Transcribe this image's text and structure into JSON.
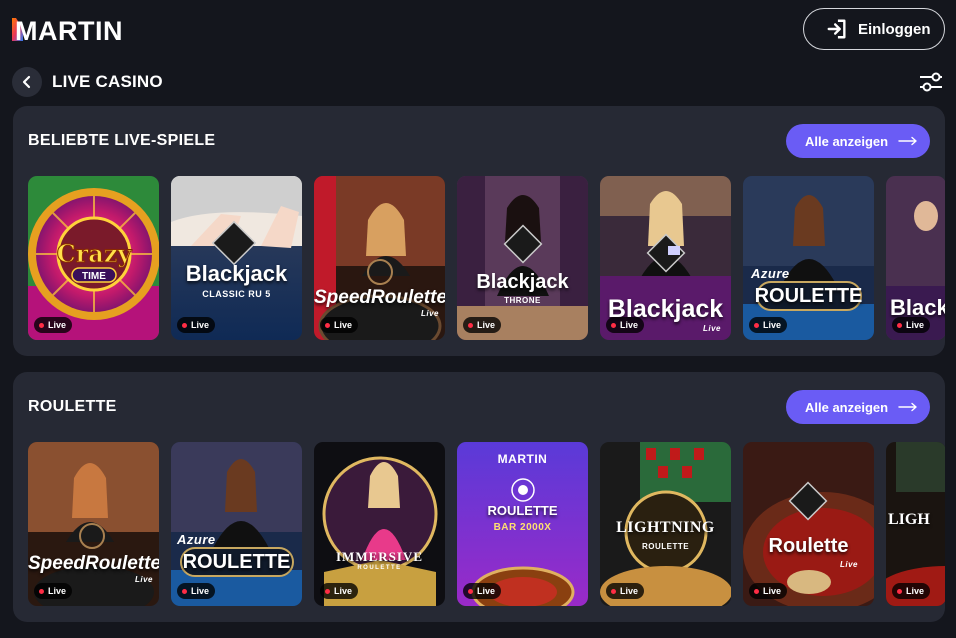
{
  "header": {
    "logo_text": "MARTIN",
    "login_label": "Einloggen"
  },
  "subheader": {
    "title": "LIVE CASINO"
  },
  "sections": [
    {
      "title": "BELIEBTE LIVE-SPIELE",
      "all_label": "Alle anzeigen",
      "cards": [
        {
          "caption": "CRAZY TIME",
          "badge": "Live"
        },
        {
          "caption": "Blackjack",
          "sub": "CLASSIC RU 5",
          "badge": "Live"
        },
        {
          "caption": "SpeedRoulette",
          "sub": "Live",
          "badge": "Live"
        },
        {
          "caption": "Blackjack",
          "sub": "THRONE",
          "badge": "Live"
        },
        {
          "caption": "Blackjack",
          "sub": "Live",
          "badge": "Live"
        },
        {
          "caption": "ROULETTE",
          "sub": "Azure",
          "badge": "Live"
        },
        {
          "caption": "Black",
          "badge": "Live"
        }
      ]
    },
    {
      "title": "ROULETTE",
      "all_label": "Alle anzeigen",
      "cards": [
        {
          "caption": "SpeedRoulette",
          "sub": "Live",
          "badge": "Live"
        },
        {
          "caption": "ROULETTE",
          "sub": "Azure",
          "badge": "Live"
        },
        {
          "caption": "IMMERSIVE",
          "sub": "ROULETTE",
          "badge": "Live"
        },
        {
          "caption": "ROULETTE",
          "sub": "BAR 2000X",
          "top": "MARTIN",
          "badge": "Live"
        },
        {
          "caption": "LIGHTNING",
          "sub": "ROULETTE",
          "badge": "Live"
        },
        {
          "caption": "Roulette",
          "sub": "Live",
          "badge": "Live"
        },
        {
          "caption": "LIGH",
          "badge": "Live"
        }
      ]
    }
  ],
  "colors": {
    "background": "#14161d",
    "panel": "#262934",
    "accent": "#6a5cf5",
    "live_dot": "#ff2d45"
  },
  "icons": {
    "login": "login-arrow-icon",
    "back": "chevron-left-icon",
    "filter": "sliders-icon",
    "arrow": "arrow-right-icon"
  }
}
